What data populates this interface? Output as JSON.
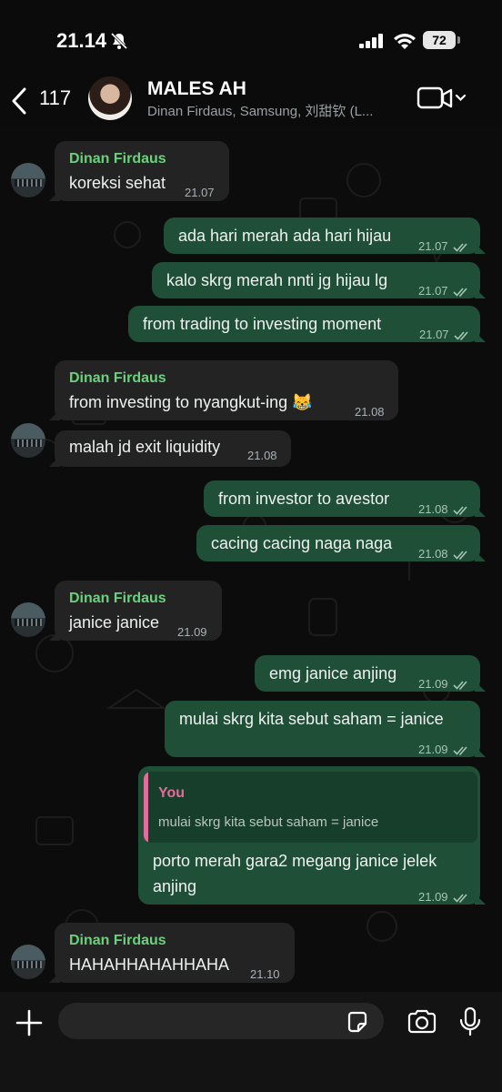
{
  "status_bar": {
    "time": "21.14",
    "battery": "72"
  },
  "header": {
    "back_count": "117",
    "title": "MALES AH",
    "subtitle": "Dinan Firdaus, Samsung, 刘甜钦 (L..."
  },
  "messages": [
    {
      "dir": "in",
      "sender": "Dinan Firdaus",
      "text": "koreksi sehat",
      "time": "21.07"
    },
    {
      "dir": "out",
      "text": "ada hari merah ada hari hijau",
      "time": "21.07"
    },
    {
      "dir": "out",
      "text": "kalo skrg merah nnti jg hijau lg",
      "time": "21.07"
    },
    {
      "dir": "out",
      "text": "from trading to investing moment",
      "time": "21.07"
    },
    {
      "dir": "in",
      "sender": "Dinan Firdaus",
      "text": "from investing to nyangkut-ing 😹",
      "time": "21.08"
    },
    {
      "dir": "in",
      "text": "malah jd exit liquidity",
      "time": "21.08"
    },
    {
      "dir": "out",
      "text": "from investor to avestor",
      "time": "21.08"
    },
    {
      "dir": "out",
      "text": "cacing cacing naga naga",
      "time": "21.08"
    },
    {
      "dir": "in",
      "sender": "Dinan Firdaus",
      "text": "janice janice",
      "time": "21.09"
    },
    {
      "dir": "out",
      "text": "emg janice anjing",
      "time": "21.09"
    },
    {
      "dir": "out",
      "text": "mulai skrg kita sebut saham = janice",
      "time": "21.09"
    },
    {
      "dir": "out",
      "quote_sender": "You",
      "quote_text": "mulai skrg kita sebut saham = janice",
      "text_line1": "porto merah gara2 megang janice jelek",
      "text_line2": "anjing",
      "time": "21.09"
    },
    {
      "dir": "in",
      "sender": "Dinan Firdaus",
      "text": "HAHAHHAHAHHAHA",
      "time": "21.10"
    }
  ],
  "composer": {
    "placeholder": ""
  },
  "icons": {
    "back": "chevron-left-icon",
    "video": "video-call-icon",
    "plus": "plus-icon",
    "sticker": "sticker-icon",
    "camera": "camera-icon",
    "mic": "microphone-icon",
    "ticks": "double-check-icon"
  },
  "colors": {
    "incoming_bubble": "#232323",
    "outgoing_bubble": "#1f4f36",
    "sender_name": "#6bd17d",
    "quote_accent": "#e26d9b",
    "background": "#0c0c0c"
  }
}
